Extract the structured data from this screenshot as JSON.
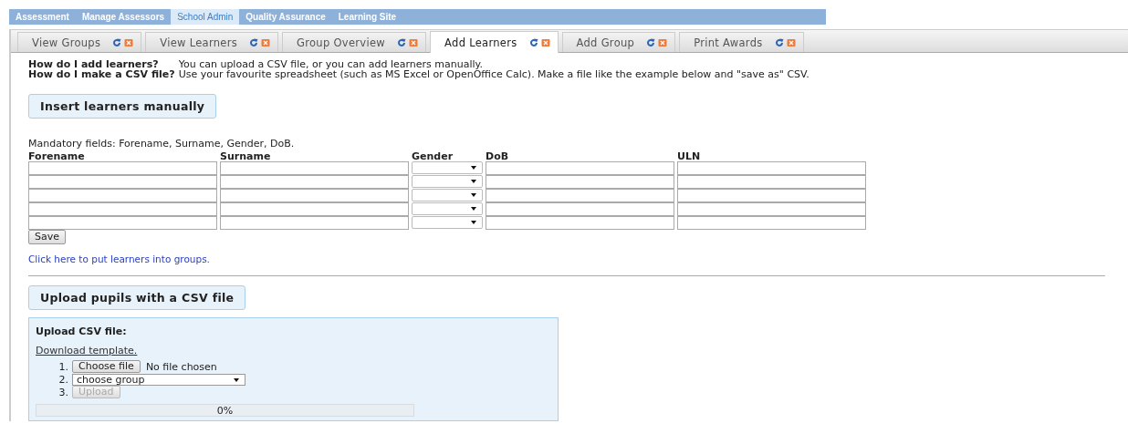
{
  "nav": [
    {
      "label": "Assessment",
      "selected": false
    },
    {
      "label": "Manage Assessors",
      "selected": false
    },
    {
      "label": "School Admin",
      "selected": true
    },
    {
      "label": "Quality Assurance",
      "selected": false
    },
    {
      "label": "Learning Site",
      "selected": false
    }
  ],
  "tabs": [
    {
      "label": "View Groups",
      "selected": false
    },
    {
      "label": "View Learners",
      "selected": false
    },
    {
      "label": "Group Overview",
      "selected": false
    },
    {
      "label": "Add Learners",
      "selected": true
    },
    {
      "label": "Add Group",
      "selected": false
    },
    {
      "label": "Print Awards",
      "selected": false
    }
  ],
  "help": [
    {
      "question": "How do I add learners?",
      "answer": "You can upload a CSV file, or you can add learners manually."
    },
    {
      "question": "How do I make a CSV file?",
      "answer": "Use your favourite spreadsheet (such as MS Excel or OpenOffice Calc). Make a file like the example below and \"save as\" CSV."
    }
  ],
  "manual": {
    "heading": "Insert learners manually",
    "note": "Mandatory fields: Forename, Surname, Gender, DoB.",
    "columns": [
      {
        "label": "Forename",
        "kind": "text"
      },
      {
        "label": "Surname",
        "kind": "text"
      },
      {
        "label": "Gender",
        "kind": "select"
      },
      {
        "label": "DoB",
        "kind": "text"
      },
      {
        "label": "ULN",
        "kind": "text"
      }
    ],
    "row_count_rows": [
      {},
      {},
      {},
      {},
      {}
    ],
    "save_button": "Save",
    "link": "Click here to put learners into groups."
  },
  "upload": {
    "heading": "Upload pupils with a CSV file",
    "panel_title": "Upload CSV file:",
    "template_link": "Download template.",
    "steps": [
      {
        "number": "1.",
        "kind": "file",
        "button": "Choose file",
        "status": "No file chosen"
      },
      {
        "number": "2.",
        "kind": "select",
        "value": "choose group"
      },
      {
        "number": "3.",
        "kind": "button",
        "button": "Upload",
        "disabled": true
      }
    ],
    "progress": {
      "level": 0,
      "reading": "0%"
    }
  }
}
